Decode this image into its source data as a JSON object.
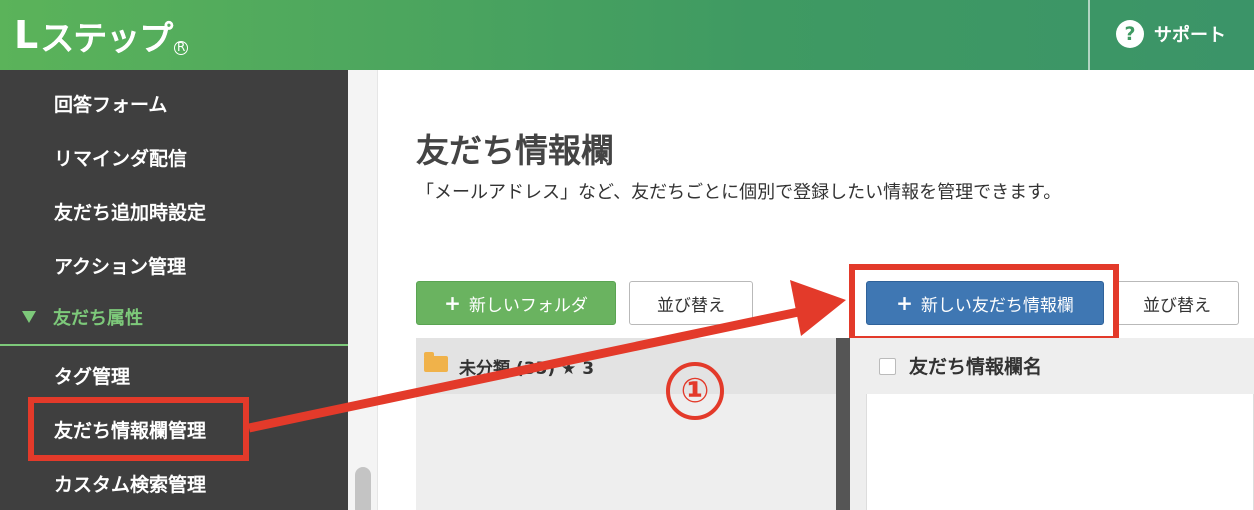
{
  "header": {
    "logo_text": "ステップ",
    "logo_l": "L",
    "logo_reg": "R",
    "support_label": "サポート",
    "support_icon": "?"
  },
  "sidebar": {
    "items": [
      {
        "label": "回答フォーム"
      },
      {
        "label": "リマインダ配信"
      },
      {
        "label": "友だち追加時設定"
      },
      {
        "label": "アクション管理"
      },
      {
        "label": "タグ管理"
      },
      {
        "label": "友だち情報欄管理"
      },
      {
        "label": "カスタム検索管理"
      }
    ],
    "section_label": "友だち属性"
  },
  "main": {
    "title": "友だち情報欄",
    "description": "「メールアドレス」など、友だちごとに個別で登録したい情報を管理できます。",
    "buttons": {
      "new_folder": "新しいフォルダ",
      "sort1": "並び替え",
      "new_info": "新しい友だち情報欄",
      "sort2": "並び替え",
      "plus": "+"
    },
    "folder_label": "未分類 (35) ★ 3",
    "table_header": "友だち情報欄名"
  },
  "annotation": {
    "step_number": "①",
    "accent_color": "#e33a2a"
  },
  "colors": {
    "header_green": "#5bb35a",
    "sidebar_bg": "#3f3f3f",
    "section_green": "#7dc97a",
    "button_green": "#6ab360",
    "button_blue": "#3f77b3"
  }
}
